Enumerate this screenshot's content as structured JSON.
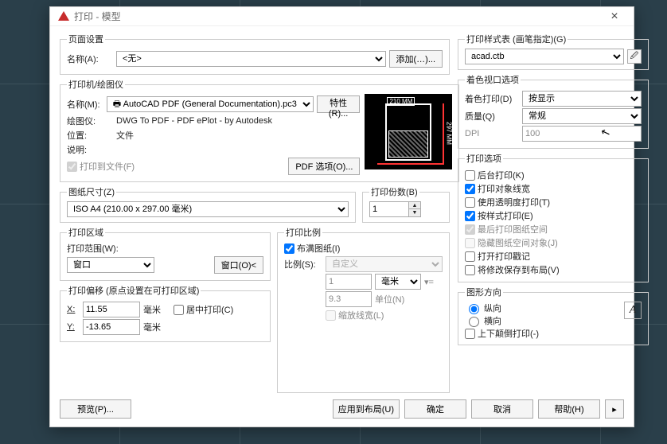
{
  "window": {
    "title": "打印 - 模型"
  },
  "pageSetup": {
    "legend": "页面设置",
    "nameLabel": "名称(A):",
    "nameValue": "<无>",
    "addBtn": "添加(…)..."
  },
  "printer": {
    "legend": "打印机/绘图仪",
    "nameLabel": "名称(M):",
    "nameValue": "🖶 AutoCAD PDF (General Documentation).pc3",
    "propsBtn": "特性(R)...",
    "plotterLabel": "绘图仪:",
    "plotterValue": "DWG To PDF - PDF ePlot - by Autodesk",
    "locationLabel": "位置:",
    "locationValue": "文件",
    "descLabel": "说明:",
    "descValue": "",
    "toFileLabel": "打印到文件(F)",
    "pdfBtn": "PDF 选项(O)...",
    "preview": {
      "w": "210 MM",
      "h": "297 MM"
    }
  },
  "paper": {
    "legend": "图纸尺寸(Z)",
    "value": "ISO A4 (210.00 x 297.00 毫米)"
  },
  "copies": {
    "legend": "打印份数(B)",
    "value": "1"
  },
  "area": {
    "legend": "打印区域",
    "whatLabel": "打印范围(W):",
    "whatValue": "窗口",
    "windowBtn": "窗口(O)<"
  },
  "scale": {
    "legend": "打印比例",
    "fitLabel": "布满图纸(I)",
    "scaleLabel": "比例(S):",
    "scaleValue": "自定义",
    "num": "1",
    "numUnit": "毫米",
    "den": "9.3",
    "denUnit": "单位(N)",
    "lwLabel": "缩放线宽(L)"
  },
  "offset": {
    "legend": "打印偏移 (原点设置在可打印区域)",
    "xLabel": "X:",
    "x": "11.55",
    "xUnit": "毫米",
    "yLabel": "Y:",
    "y": "-13.65",
    "yUnit": "毫米",
    "centerLabel": "居中打印(C)"
  },
  "styleTable": {
    "legend": "打印样式表 (画笔指定)(G)",
    "value": "acad.ctb"
  },
  "viewport": {
    "legend": "着色视口选项",
    "shadeLabel": "着色打印(D)",
    "shadeValue": "按显示",
    "qualityLabel": "质量(Q)",
    "qualityValue": "常规",
    "dpiLabel": "DPI",
    "dpiValue": "100"
  },
  "options": {
    "legend": "打印选项",
    "items": [
      {
        "label": "后台打印(K)",
        "checked": false,
        "enabled": true
      },
      {
        "label": "打印对象线宽",
        "checked": true,
        "enabled": true
      },
      {
        "label": "使用透明度打印(T)",
        "checked": false,
        "enabled": true
      },
      {
        "label": "按样式打印(E)",
        "checked": true,
        "enabled": true
      },
      {
        "label": "最后打印图纸空间",
        "checked": true,
        "enabled": false
      },
      {
        "label": "隐藏图纸空间对象(J)",
        "checked": false,
        "enabled": false
      },
      {
        "label": "打开打印戳记",
        "checked": false,
        "enabled": true
      },
      {
        "label": "将修改保存到布局(V)",
        "checked": false,
        "enabled": true
      }
    ]
  },
  "orientation": {
    "legend": "图形方向",
    "portrait": "纵向",
    "landscape": "横向",
    "upsideDown": "上下颠倒打印(-)",
    "selected": "portrait"
  },
  "buttons": {
    "preview": "预览(P)...",
    "apply": "应用到布局(U)",
    "ok": "确定",
    "cancel": "取消",
    "help": "帮助(H)"
  }
}
